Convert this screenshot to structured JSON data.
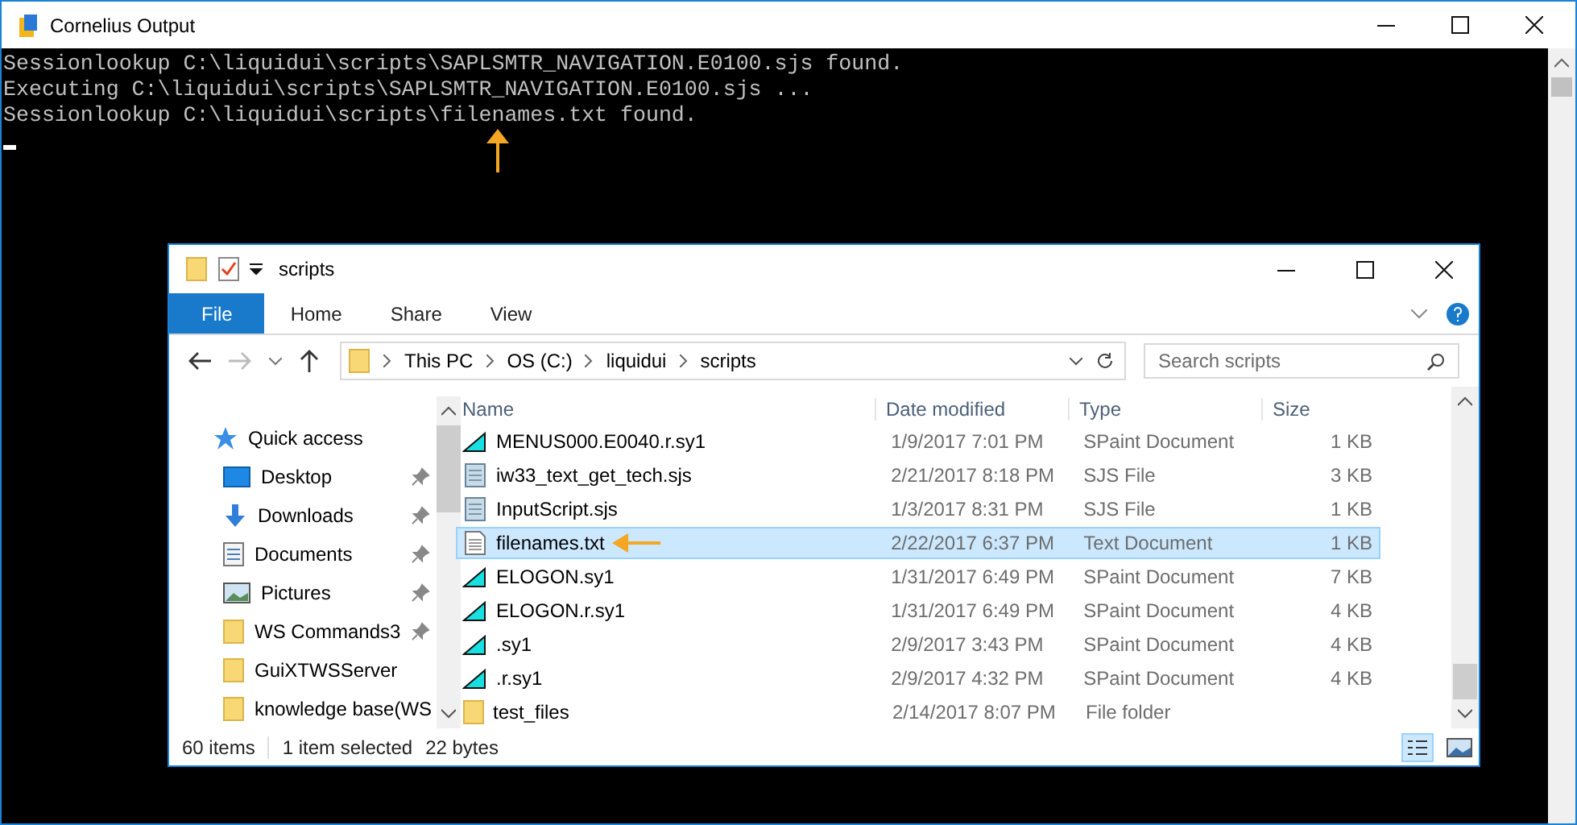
{
  "window": {
    "title": "Cornelius Output"
  },
  "console": {
    "lines": [
      "Sessionlookup C:\\liquidui\\scripts\\SAPLSMTR_NAVIGATION.E0100.sjs found.",
      "Executing C:\\liquidui\\scripts\\SAPLSMTR_NAVIGATION.E0100.sjs ...",
      "Sessionlookup C:\\liquidui\\scripts\\filenames.txt found."
    ]
  },
  "explorer": {
    "title": "scripts",
    "ribbon_tabs": [
      {
        "label": "File",
        "selected": true
      },
      {
        "label": "Home",
        "selected": false
      },
      {
        "label": "Share",
        "selected": false
      },
      {
        "label": "View",
        "selected": false
      }
    ],
    "breadcrumb": [
      "This PC",
      "OS (C:)",
      "liquidui",
      "scripts"
    ],
    "search": {
      "placeholder": "Search scripts"
    },
    "nav_items": [
      {
        "label": "Quick access",
        "kind": "star",
        "pinned": false
      },
      {
        "label": "Desktop",
        "kind": "desktop",
        "pinned": true
      },
      {
        "label": "Downloads",
        "kind": "download",
        "pinned": true
      },
      {
        "label": "Documents",
        "kind": "documents",
        "pinned": true
      },
      {
        "label": "Pictures",
        "kind": "pictures",
        "pinned": true
      },
      {
        "label": "WS Commands3",
        "kind": "folder",
        "pinned": true
      },
      {
        "label": "GuiXTWSServer",
        "kind": "folder",
        "pinned": false
      },
      {
        "label": "knowledge base(WS",
        "kind": "folder",
        "pinned": false
      }
    ],
    "columns": [
      "Name",
      "Date modified",
      "Type",
      "Size"
    ],
    "rows": [
      {
        "name": "MENUS000.E0040.r.sy1",
        "date": "1/9/2017 7:01 PM",
        "type": "SPaint Document",
        "size": "1 KB",
        "kind": "spaint",
        "selected": false
      },
      {
        "name": "iw33_text_get_tech.sjs",
        "date": "2/21/2017 8:18 PM",
        "type": "SJS File",
        "size": "3 KB",
        "kind": "script",
        "selected": false
      },
      {
        "name": "InputScript.sjs",
        "date": "1/3/2017 8:31 PM",
        "type": "SJS File",
        "size": "1 KB",
        "kind": "script",
        "selected": false
      },
      {
        "name": "filenames.txt",
        "date": "2/22/2017 6:37 PM",
        "type": "Text Document",
        "size": "1 KB",
        "kind": "text",
        "selected": true
      },
      {
        "name": "ELOGON.sy1",
        "date": "1/31/2017 6:49 PM",
        "type": "SPaint Document",
        "size": "7 KB",
        "kind": "spaint",
        "selected": false
      },
      {
        "name": "ELOGON.r.sy1",
        "date": "1/31/2017 6:49 PM",
        "type": "SPaint Document",
        "size": "4 KB",
        "kind": "spaint",
        "selected": false
      },
      {
        "name": ".sy1",
        "date": "2/9/2017 3:43 PM",
        "type": "SPaint Document",
        "size": "4 KB",
        "kind": "spaint",
        "selected": false
      },
      {
        "name": ".r.sy1",
        "date": "2/9/2017 4:32 PM",
        "type": "SPaint Document",
        "size": "4 KB",
        "kind": "spaint",
        "selected": false
      },
      {
        "name": "test_files",
        "date": "2/14/2017 8:07 PM",
        "type": "File folder",
        "size": "",
        "kind": "folder",
        "selected": false
      }
    ],
    "status": [
      "60 items",
      "1 item selected",
      "22 bytes"
    ]
  }
}
